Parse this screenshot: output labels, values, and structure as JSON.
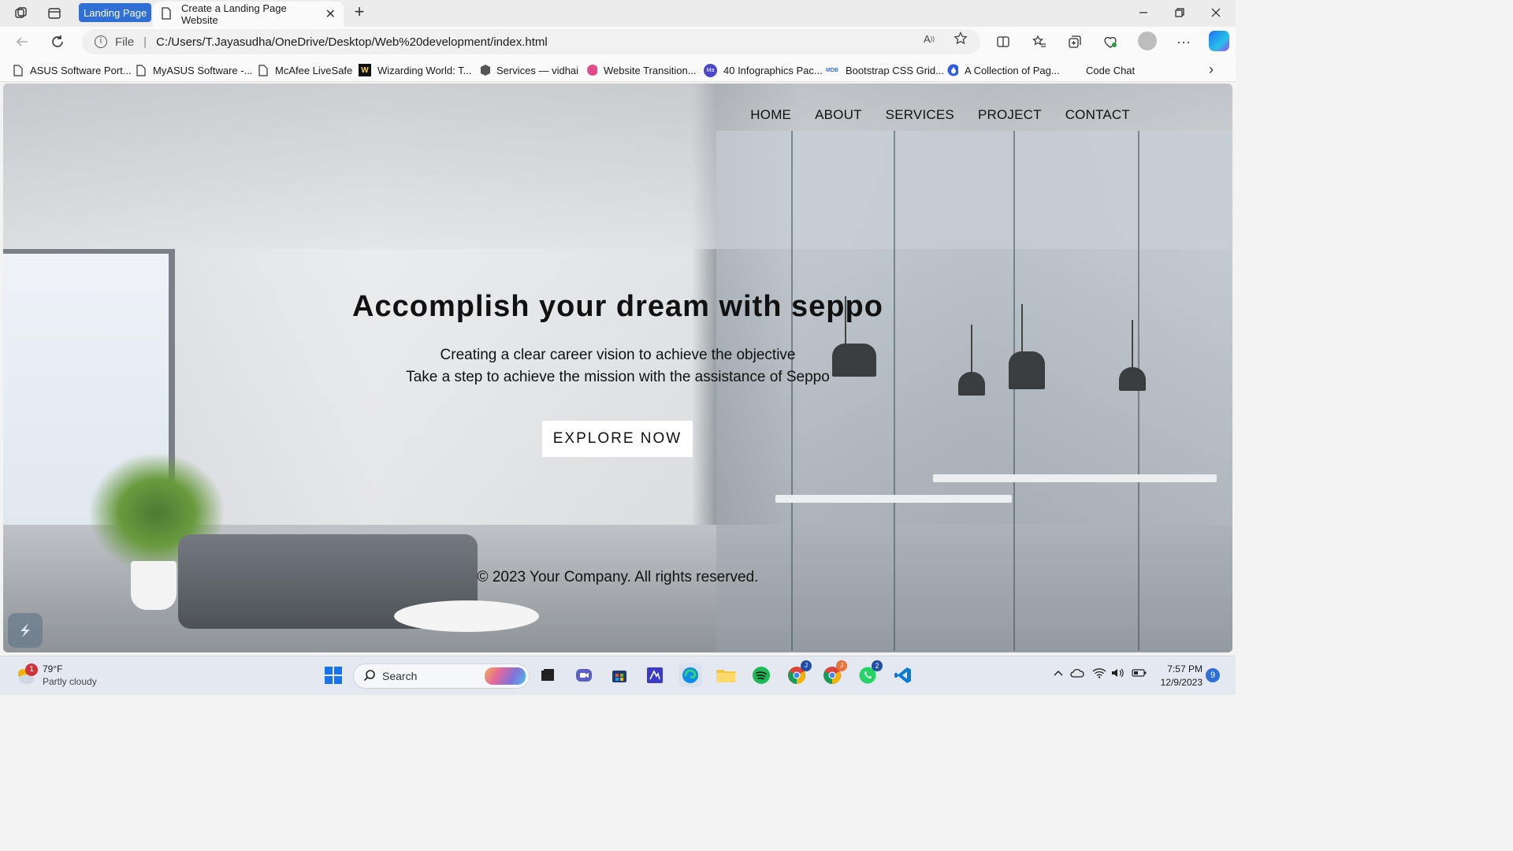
{
  "browser": {
    "tab_group_label": "Landing Page",
    "tab_title": "Create a Landing Page Website",
    "address": {
      "scheme": "File",
      "url": "C:/Users/T.Jayasudha/OneDrive/Desktop/Web%20development/index.html"
    },
    "bookmarks": [
      {
        "label": "ASUS Software Port...",
        "icon": "page-icon"
      },
      {
        "label": "MyASUS Software -...",
        "icon": "page-icon"
      },
      {
        "label": "McAfee LiveSafe",
        "icon": "page-icon"
      },
      {
        "label": "Wizarding World: T...",
        "icon": "wizarding-icon"
      },
      {
        "label": "Services — vidhai",
        "icon": "cube-icon"
      },
      {
        "label": "Website Transition...",
        "icon": "dribbble-icon"
      },
      {
        "label": "40 Infographics Pac...",
        "icon": "ma-icon"
      },
      {
        "label": "Bootstrap CSS Grid...",
        "icon": "mdb-icon"
      },
      {
        "label": "A Collection of Pag...",
        "icon": "drop-icon"
      },
      {
        "label": "Code Chat",
        "icon": "none"
      }
    ]
  },
  "page": {
    "nav": [
      "HOME",
      "ABOUT",
      "SERVICES",
      "PROJECT",
      "CONTACT"
    ],
    "hero_title": "Accomplish your dream with seppo",
    "hero_line1": "Creating a clear career vision to achieve the objective",
    "hero_line2": "Take a step to achieve the mission with the assistance of Seppo",
    "cta": "EXPLORE NOW",
    "footer": "© 2023 Your Company. All rights reserved."
  },
  "taskbar": {
    "weather_badge": "1",
    "temperature": "79°F",
    "condition": "Partly cloudy",
    "search_placeholder": "Search",
    "time": "7:57 PM",
    "date": "12/9/2023",
    "notification_count": "9",
    "badges": {
      "chrome1": "J",
      "chrome2": "J",
      "whatsapp": "2"
    }
  },
  "colors": {
    "tab_group": "#2f6fd6",
    "accent_edge": "#1b6ef3"
  }
}
